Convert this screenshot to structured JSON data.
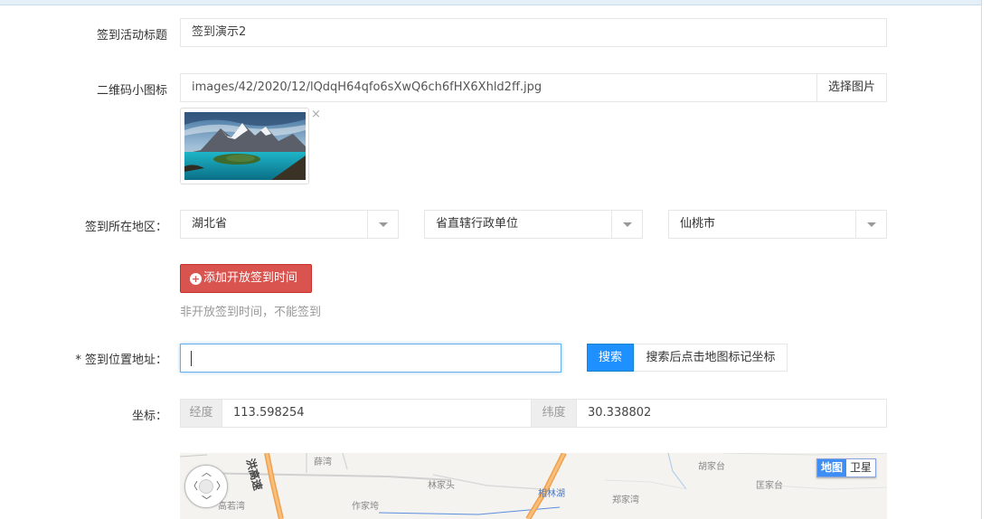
{
  "form": {
    "title_label": "签到活动标题",
    "title_value": "签到演示2",
    "qr_label": "二维码小图标",
    "qr_path": "images/42/2020/12/lQdqH64qfo6sXwQ6ch6fHX6Xhld2ff.jpg",
    "choose_image": "选择图片",
    "remove_glyph": "×",
    "region_label": "签到所在地区：",
    "province": "湖北省",
    "city": "省直辖行政单位",
    "district": "仙桃市",
    "add_time_button": "添加开放签到时间",
    "add_time_help": "非开放签到时间，不能签到",
    "address_label": "* 签到位置地址：",
    "address_value": "",
    "search_button": "搜索",
    "search_hint": "搜索后点击地图标记坐标",
    "coord_label": "坐标：",
    "lng_label": "经度",
    "lng_value": "113.598254",
    "lat_label": "纬度",
    "lat_value": "30.338802"
  },
  "map": {
    "mode_map": "地图",
    "mode_satellite": "卫星",
    "places": [
      "薛湾",
      "林家头",
      "相林湖",
      "郑家湾",
      "胡家台",
      "匡家台",
      "高若湾",
      "作家垮"
    ],
    "road_name": "洪高速"
  },
  "colors": {
    "danger": "#d9534f",
    "primary": "#1e90ff",
    "focus": "#66afe9"
  }
}
